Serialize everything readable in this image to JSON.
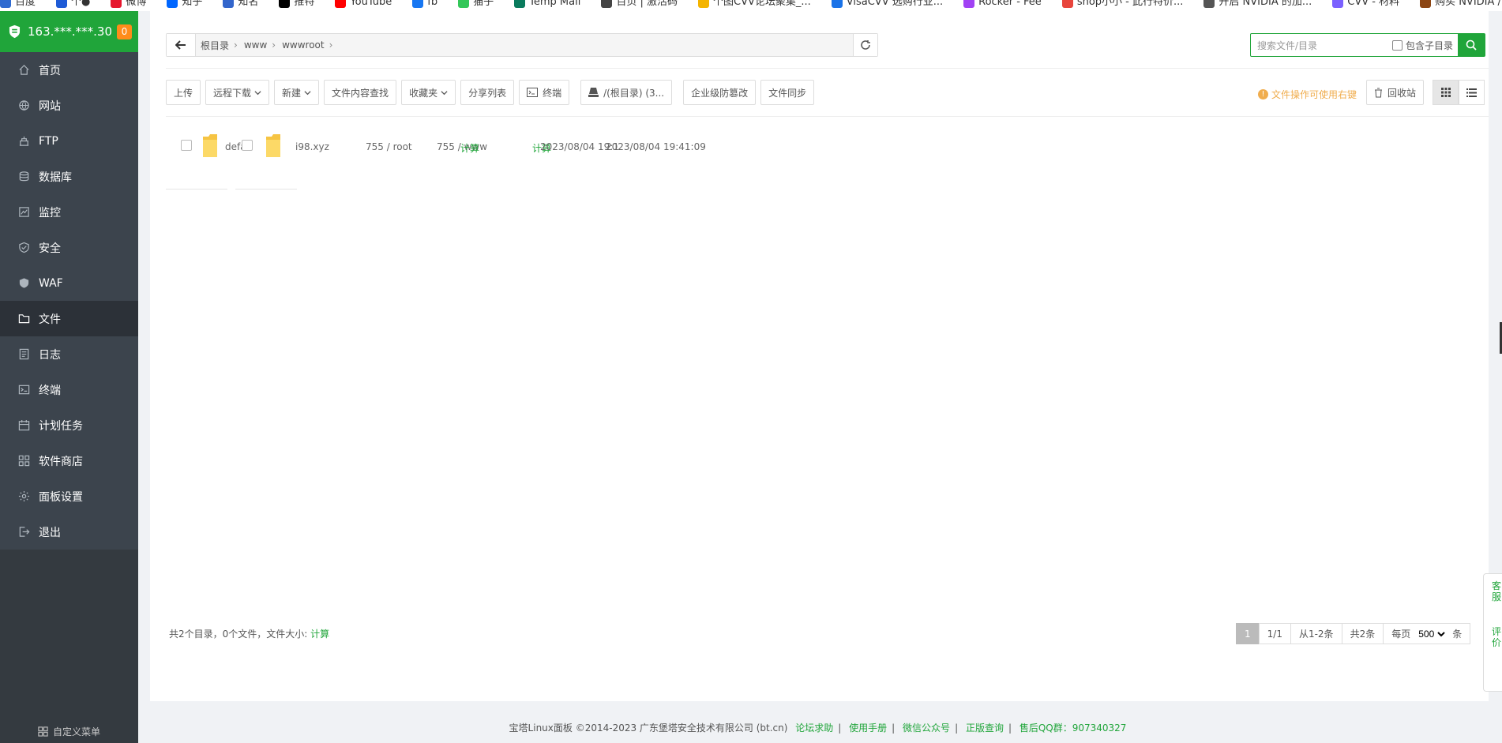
{
  "bookmarks": [
    {
      "label": "百度",
      "color": "#2f6ad0"
    },
    {
      "label": "个●",
      "color": "#1e5bd6"
    },
    {
      "label": "微博",
      "color": "#e6162d"
    },
    {
      "label": "知乎",
      "color": "#0066ff"
    },
    {
      "label": "知名",
      "color": "#3366cc"
    },
    {
      "label": "推特",
      "color": "#000000"
    },
    {
      "label": "YouTube",
      "color": "#ff0000"
    },
    {
      "label": "fb",
      "color": "#1877f2"
    },
    {
      "label": "猫子",
      "color": "#34c759"
    },
    {
      "label": "Temp Mail",
      "color": "#0a7b5d"
    },
    {
      "label": "百页 | 激活码",
      "color": "#444444"
    },
    {
      "label": "个图CVV论坛聚集_...",
      "color": "#f4b400"
    },
    {
      "label": "VisaCVV 选购行业...",
      "color": "#1a73e8"
    },
    {
      "label": "Rocker - Fee",
      "color": "#a142f4"
    },
    {
      "label": "shop小小 - 此行特价...",
      "color": "#e8453c"
    },
    {
      "label": "开启 NVIDIA 的加...",
      "color": "#555555"
    },
    {
      "label": "CVV - 材料",
      "color": "#7b61ff"
    },
    {
      "label": "购买 NVIDIA / PROXY...",
      "color": "#8b4513"
    }
  ],
  "server": {
    "ip": "163.***.***.30",
    "badge": "0"
  },
  "nav": [
    {
      "label": "首页",
      "icon": "home-icon"
    },
    {
      "label": "网站",
      "icon": "globe-icon"
    },
    {
      "label": "FTP",
      "icon": "ftp-icon"
    },
    {
      "label": "数据库",
      "icon": "database-icon"
    },
    {
      "label": "监控",
      "icon": "monitor-icon"
    },
    {
      "label": "安全",
      "icon": "shield-check-icon"
    },
    {
      "label": "WAF",
      "icon": "waf-shield-icon"
    },
    {
      "label": "文件",
      "icon": "folder-icon",
      "active": true
    },
    {
      "label": "日志",
      "icon": "log-icon"
    },
    {
      "label": "终端",
      "icon": "terminal-icon"
    },
    {
      "label": "计划任务",
      "icon": "calendar-icon"
    },
    {
      "label": "软件商店",
      "icon": "grid-icon"
    },
    {
      "label": "面板设置",
      "icon": "gear-icon"
    },
    {
      "label": "退出",
      "icon": "logout-icon"
    }
  ],
  "custom_menu": "自定义菜单",
  "path": {
    "crumbs": [
      "根目录",
      "www",
      "wwwroot"
    ]
  },
  "search": {
    "placeholder": "搜索文件/目录",
    "include_sub": "包含子目录"
  },
  "toolbar": {
    "upload": "上传",
    "remote_download": "远程下载",
    "new": "新建",
    "content_search": "文件内容查找",
    "favorites": "收藏夹",
    "share_list": "分享列表",
    "terminal": "终端",
    "disk": "/(根目录) (3...",
    "tamper": "企业级防篡改",
    "sync": "文件同步",
    "hint": "文件操作可使用右键",
    "recycle": "回收站"
  },
  "files": {
    "row1_name": "defa",
    "row2_name": "i98.xyz",
    "perm1": "755 / root",
    "perm2": "755 / www",
    "overlap_green": "计算",
    "date_a": "2023/08/04 19:1",
    "date_b": "2023/08/04 19:41:09",
    "overlap_mark": "计算"
  },
  "summary": {
    "text": "共2个目录，0个文件，文件大小:",
    "calc": "计算"
  },
  "pager": {
    "current": "1",
    "pages": "1/1",
    "range": "从1-2条",
    "total": "共2条",
    "per_page_label": "每页",
    "per_page": "500",
    "unit": "条"
  },
  "footer": {
    "copyright": "宝塔Linux面板 ©2014-2023 广东堡塔安全技术有限公司 (bt.cn)",
    "forum": "论坛求助",
    "manual": "使用手册",
    "wechat": "微信公众号",
    "verify": "正版查询",
    "qq": "售后QQ群：907340327"
  },
  "float_tab": {
    "service": "客服",
    "review": "评价"
  }
}
